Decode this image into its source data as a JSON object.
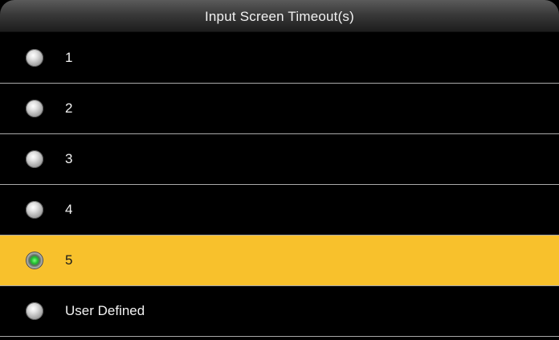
{
  "header": {
    "title": "Input Screen Timeout(s)"
  },
  "options": [
    {
      "label": "1",
      "selected": false
    },
    {
      "label": "2",
      "selected": false
    },
    {
      "label": "3",
      "selected": false
    },
    {
      "label": "4",
      "selected": false
    },
    {
      "label": "5",
      "selected": true
    },
    {
      "label": "User Defined",
      "selected": false
    }
  ],
  "colors": {
    "background": "#000000",
    "selected_row": "#f8c12c",
    "divider": "#a9a9a9",
    "radio_checked_dot": "#1fbf2d",
    "text": "#f2f2f2"
  },
  "icons": {
    "radio_unchecked": "radio-unchecked-icon",
    "radio_checked": "radio-checked-icon"
  }
}
